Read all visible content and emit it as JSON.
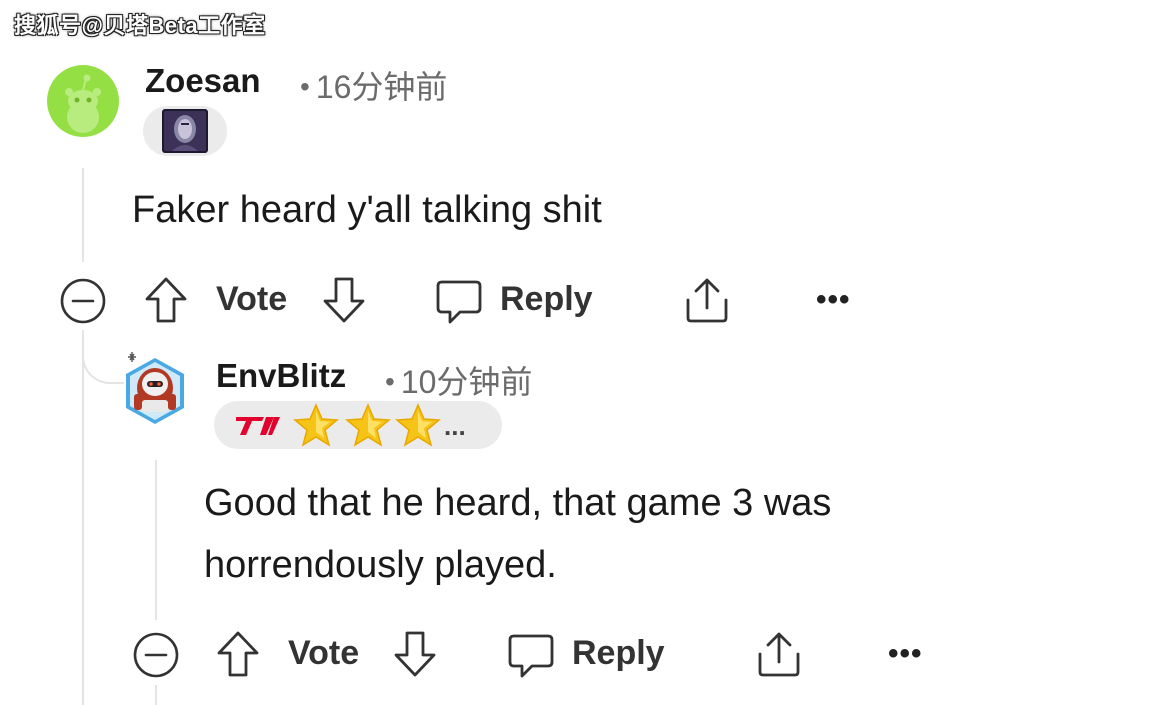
{
  "watermark": "搜狐号@贝塔Beta工作室",
  "comments": [
    {
      "username": "Zoesan",
      "time": "16分钟前",
      "body": "Faker heard y'all talking shit",
      "actions": {
        "vote": "Vote",
        "reply": "Reply",
        "more": "•••"
      }
    },
    {
      "username": "EnvBlitz",
      "time": "10分钟前",
      "flair": {
        "team_logo_text": "T1",
        "more": "..."
      },
      "body_lines": [
        "Good that he heard, that game 3 was",
        "horrendously played."
      ],
      "actions": {
        "vote": "Vote",
        "reply": "Reply",
        "more": "•••"
      }
    }
  ],
  "colors": {
    "avatar_green": "#94e044",
    "text": "#1a1a1b",
    "meta": "#6b6b6b",
    "pill": "#ebebeb",
    "t1_red": "#e2012d",
    "star": "#f5c417"
  }
}
